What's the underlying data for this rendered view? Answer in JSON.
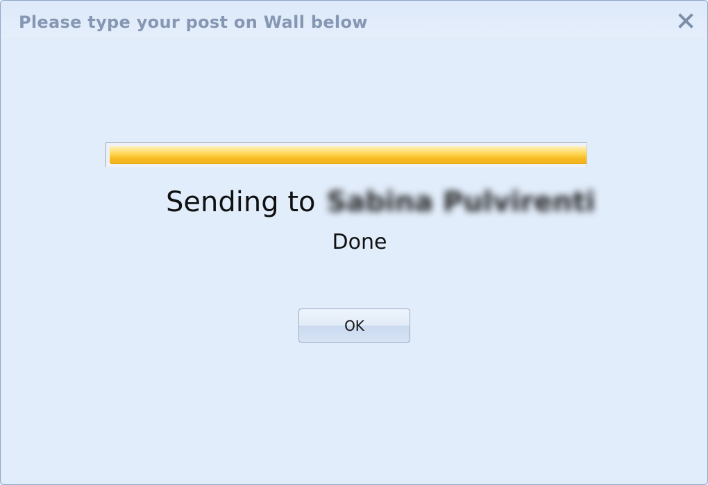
{
  "dialog": {
    "title": "Please type your post on Wall below",
    "close_icon": "close-icon"
  },
  "progress": {
    "percent": 100,
    "fill_color": "#f5bb22"
  },
  "message": {
    "sending_prefix": "Sending to",
    "recipient": "Sabina Pulvirenti",
    "status": "Done"
  },
  "buttons": {
    "ok_label": "OK"
  }
}
